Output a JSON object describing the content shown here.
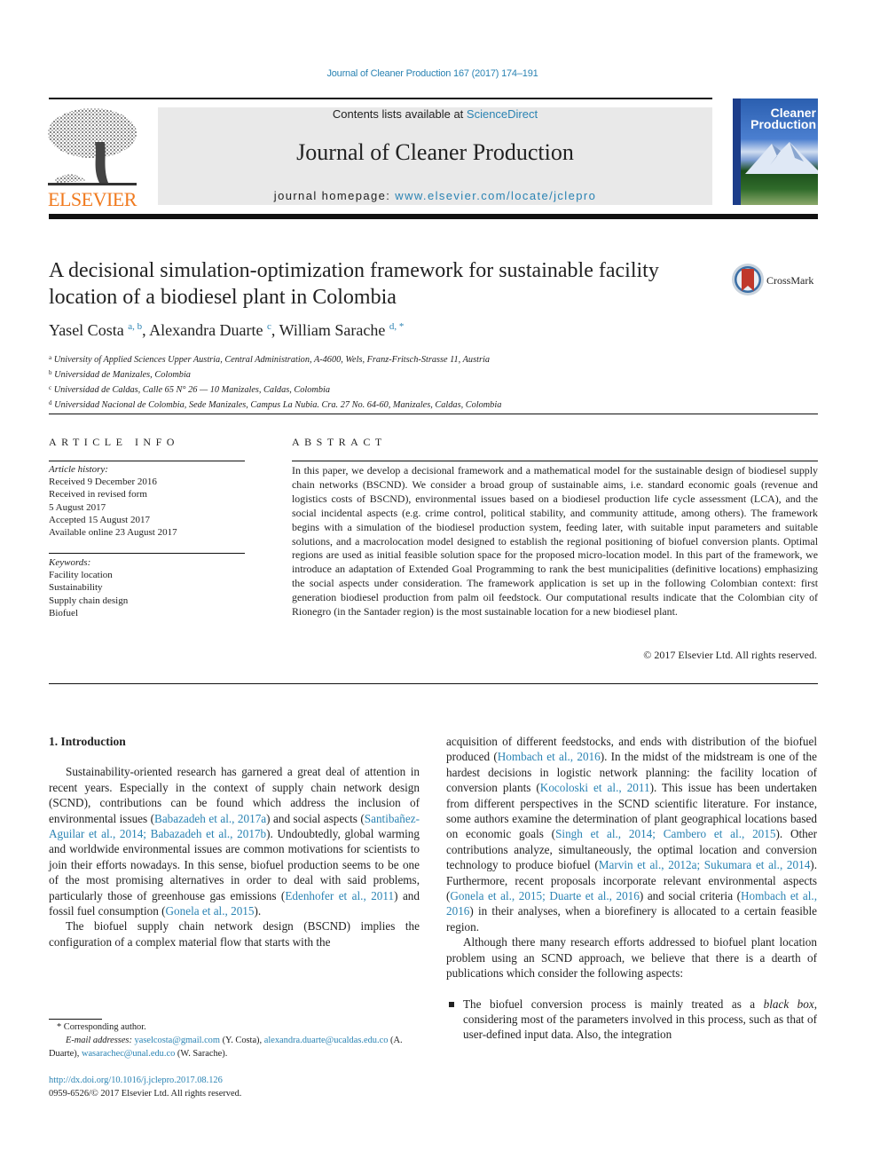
{
  "header": {
    "journal_ref": "Journal of Cleaner Production 167 (2017) 174–191",
    "contents_prefix": "Contents lists available at ",
    "contents_link": "ScienceDirect",
    "journal_title": "Journal of Cleaner Production",
    "homepage_prefix": "journal homepage: ",
    "homepage_link": "www.elsevier.com/locate/jclepro",
    "publisher_logo_text": "ELSEVIER",
    "cover": {
      "title_line1": "Cleaner",
      "title_line2": "Production"
    },
    "colors": {
      "link": "#2a83b3",
      "elsevier_orange": "#f07a1e",
      "header_box": "#e9e9e9"
    }
  },
  "article": {
    "title": "A decisional simulation-optimization framework for sustainable facility location of a biodiesel plant in Colombia",
    "crossmark_label": "CrossMark",
    "authors": [
      {
        "name": "Yasel Costa",
        "sup": "a, b",
        "sep": ", "
      },
      {
        "name": "Alexandra Duarte",
        "sup": "c",
        "sep": ", "
      },
      {
        "name": "William Sarache",
        "sup": "d, *",
        "sep": ""
      }
    ],
    "affiliations": [
      {
        "key": "a",
        "text": "University of Applied Sciences Upper Austria, Central Administration, A-4600, Wels, Franz-Fritsch-Strasse 11, Austria"
      },
      {
        "key": "b",
        "text": "Universidad de Manizales, Colombia"
      },
      {
        "key": "c",
        "text": "Universidad de Caldas, Calle 65 N° 26 — 10 Manizales, Caldas, Colombia"
      },
      {
        "key": "d",
        "text": "Universidad Nacional de Colombia, Sede Manizales, Campus La Nubia. Cra. 27 No. 64-60, Manizales, Caldas, Colombia"
      }
    ]
  },
  "article_info": {
    "heading": "ARTICLE INFO",
    "history_label": "Article history:",
    "history": [
      "Received 9 December 2016",
      "Received in revised form",
      "5 August 2017",
      "Accepted 15 August 2017",
      "Available online 23 August 2017"
    ],
    "keywords_label": "Keywords:",
    "keywords": [
      "Facility location",
      "Sustainability",
      "Supply chain design",
      "Biofuel"
    ]
  },
  "abstract": {
    "heading": "ABSTRACT",
    "text": "In this paper, we develop a decisional framework and a mathematical model for the sustainable design of biodiesel supply chain networks (BSCND). We consider a broad group of sustainable aims, i.e. standard economic goals (revenue and logistics costs of BSCND), environmental issues based on a biodiesel pro­duction life cycle assessment (LCA), and the social incidental aspects (e.g. crime control, political stability, and community attitude, among others). The framework begins with a simulation of the biodiesel production system, feeding later, with suitable input parameters and suitable solutions, and a macro­location model designed to establish the regional positioning of biofuel conversion plants. Optimal re­gions are used as initial feasible solution space for the proposed micro-location model. In this part of the framework, we introduce an adaptation of Extended Goal Programming to rank the best municipalities (definitive locations) emphasizing the social aspects under consideration. The framework application is set up in the following Colombian context: first generation biodiesel production from palm oil feedstock. Our computational results indicate that the Colombian city of Rionegro (in the Santader region) is the most sustainable location for a new biodiesel plant.",
    "copyright": "© 2017 Elsevier Ltd. All rights reserved."
  },
  "body": {
    "section_heading": "1.  Introduction",
    "p1": [
      {
        "t": "Sustainability-oriented research has garnered a great deal of attention in recent years. Especially in the context of supply chain network design (SCND), contributions can be found which address the inclusion of environmental issues ("
      },
      {
        "link": "Babazadeh et al., 2017a"
      },
      {
        "t": ") and social aspects ("
      },
      {
        "link": "Santibañez-Aguilar et al., 2014; Babazadeh et al., 2017b"
      },
      {
        "t": "). Undoubtedly, global warming and worldwide environ­mental issues are common motivations for scientists to join their efforts nowadays. In this sense, biofuel production seems to be one of the most promising alternatives in order to deal with said problems, particularly those of greenhouse gas emissions ("
      },
      {
        "link": "Edenhofer et al., 2011"
      },
      {
        "t": ") and fossil fuel consumption ("
      },
      {
        "link": "Gonela et al., 2015"
      },
      {
        "t": ")."
      }
    ],
    "p2": [
      {
        "t": "The biofuel supply chain network design (BSCND) implies the configuration of a complex material flow that starts with the acquisition of different feedstocks, and ends with distribution of the biofuel produced ("
      },
      {
        "link": "Hombach et al., 2016"
      },
      {
        "t": "). In the midst of the midstream is one of the hardest decisions in logistic network planning: the facility location of conversion plants ("
      },
      {
        "link": "Kocoloski et al., 2011"
      },
      {
        "t": "). This issue has been undertaken from different perspectives in the SCND scientific literature. For instance, some authors examine the determination of plant geographical locations based on economic goals ("
      },
      {
        "link": "Singh et al., 2014; Cambero et al., 2015"
      },
      {
        "t": "). Other contributions analyze, simultaneously, the optimal location and conversion technology to produce biofuel ("
      },
      {
        "link": "Marvin et al., 2012a; Sukumara et al., 2014"
      },
      {
        "t": "). Furthermore, recent proposals incorporate relevant environmental aspects ("
      },
      {
        "link": "Gonela et al., 2015; Duarte et al., 2016"
      },
      {
        "t": ") and social criteria ("
      },
      {
        "link": "Hombach et al., 2016"
      },
      {
        "t": ") in their analyses, when a biorefinery is allocated to a certain feasible region."
      }
    ],
    "p3": "Although there many research efforts addressed to biofuel plant location problem using an SCND approach, we believe that there is a dearth of publications which consider the following aspects:",
    "bullet1": [
      {
        "t": "The biofuel conversion process is mainly treated as a "
      },
      {
        "em": "black box"
      },
      {
        "t": ", considering most of the parameters involved in this process, such as that of user-defined input data. Also, the integration"
      }
    ]
  },
  "footnotes": {
    "corresponding": "* Corresponding author.",
    "email_label": "E-mail addresses:",
    "emails": [
      {
        "email": "yaselcosta@gmail.com",
        "who": " (Y. Costa), "
      },
      {
        "email": "alexandra.duarte@ucaldas.edu.co",
        "who": " (A. Duarte), "
      },
      {
        "email": "wasarachec@unal.edu.co",
        "who": " (W. Sarache)."
      }
    ],
    "doi": "http://dx.doi.org/10.1016/j.jclepro.2017.08.126",
    "issn_copyright": "0959-6526/© 2017 Elsevier Ltd. All rights reserved."
  }
}
